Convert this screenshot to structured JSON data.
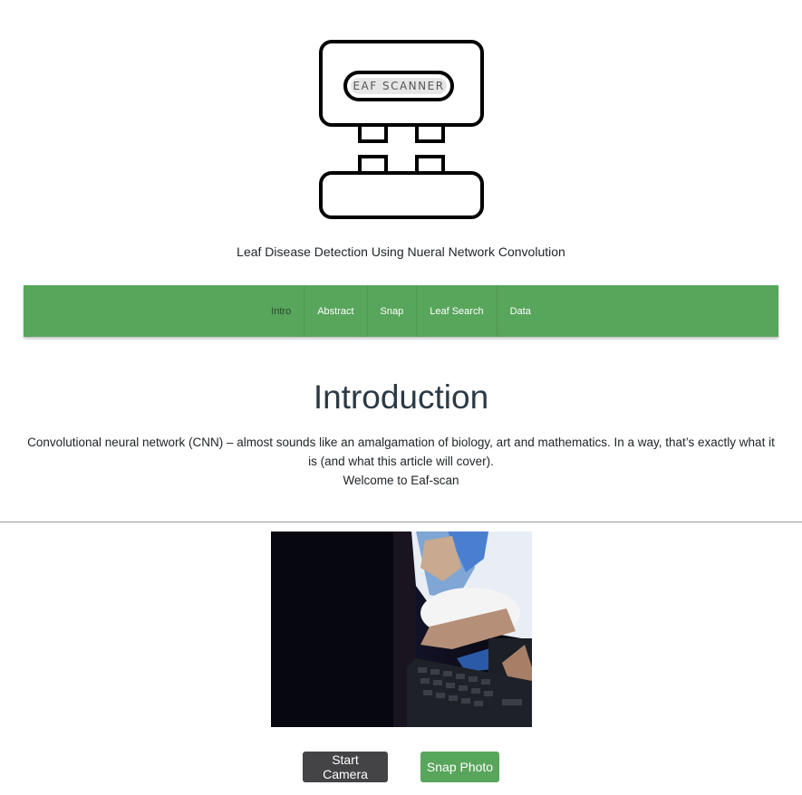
{
  "logo": {
    "text": "EAF SCANNER"
  },
  "subtitle": "Leaf Disease Detection Using Nueral Network Convolution",
  "nav": {
    "items": [
      {
        "label": "Intro",
        "active": true
      },
      {
        "label": "Abstract",
        "active": false
      },
      {
        "label": "Snap",
        "active": false
      },
      {
        "label": "Leaf Search",
        "active": false
      },
      {
        "label": "Data",
        "active": false
      }
    ],
    "color": "#58a55c"
  },
  "intro": {
    "heading": "Introduction",
    "line1": "Convolutional neural network (CNN) – almost sounds like an amalgamation of biology, art and mathematics. In a way, that’s exactly what it is (and what this article will cover).",
    "line2": "Welcome to Eaf-scan"
  },
  "camera": {
    "icon": "camera-feed-image"
  },
  "buttons": {
    "start_camera": "Start Camera",
    "snap_photo": "Snap Photo"
  }
}
